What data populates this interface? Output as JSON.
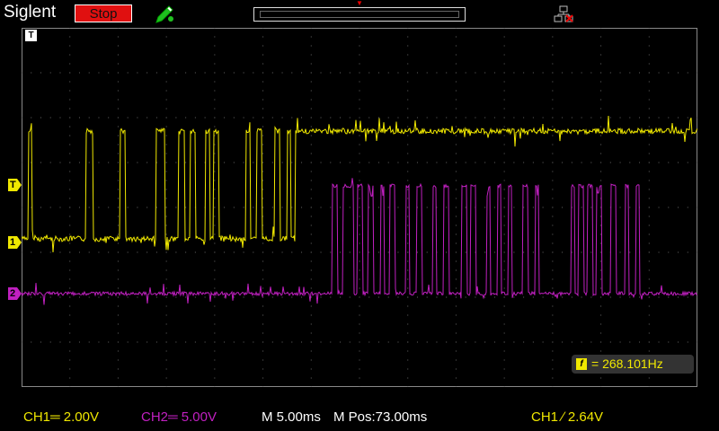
{
  "header": {
    "brand": "Siglent",
    "run_state_label": "Stop",
    "run_state_color": "#e01010"
  },
  "icons": {
    "probe": "pen-probe-icon",
    "network": "network-disconnected-icon",
    "trigger_marker": "trigger-level-marker",
    "ch1_marker": "ch1-ground-marker",
    "ch2_marker": "ch2-ground-marker"
  },
  "screen": {
    "trigger_top_label": "T",
    "trig_marker_label": "T",
    "ch1_marker_label": "1",
    "ch2_marker_label": "2"
  },
  "measurement": {
    "icon_label": "f",
    "frequency": "= 268.101Hz"
  },
  "status": {
    "ch1_scale": "CH1═ 2.00V",
    "ch2_scale": "CH2═ 5.00V",
    "timebase": "M 5.00ms",
    "mpos": "M Pos:73.00ms",
    "trigger": "CH1 ∕ 2.64V"
  },
  "colors": {
    "ch1": "#f0e800",
    "ch2": "#c020c0",
    "grid": "#777777"
  }
}
